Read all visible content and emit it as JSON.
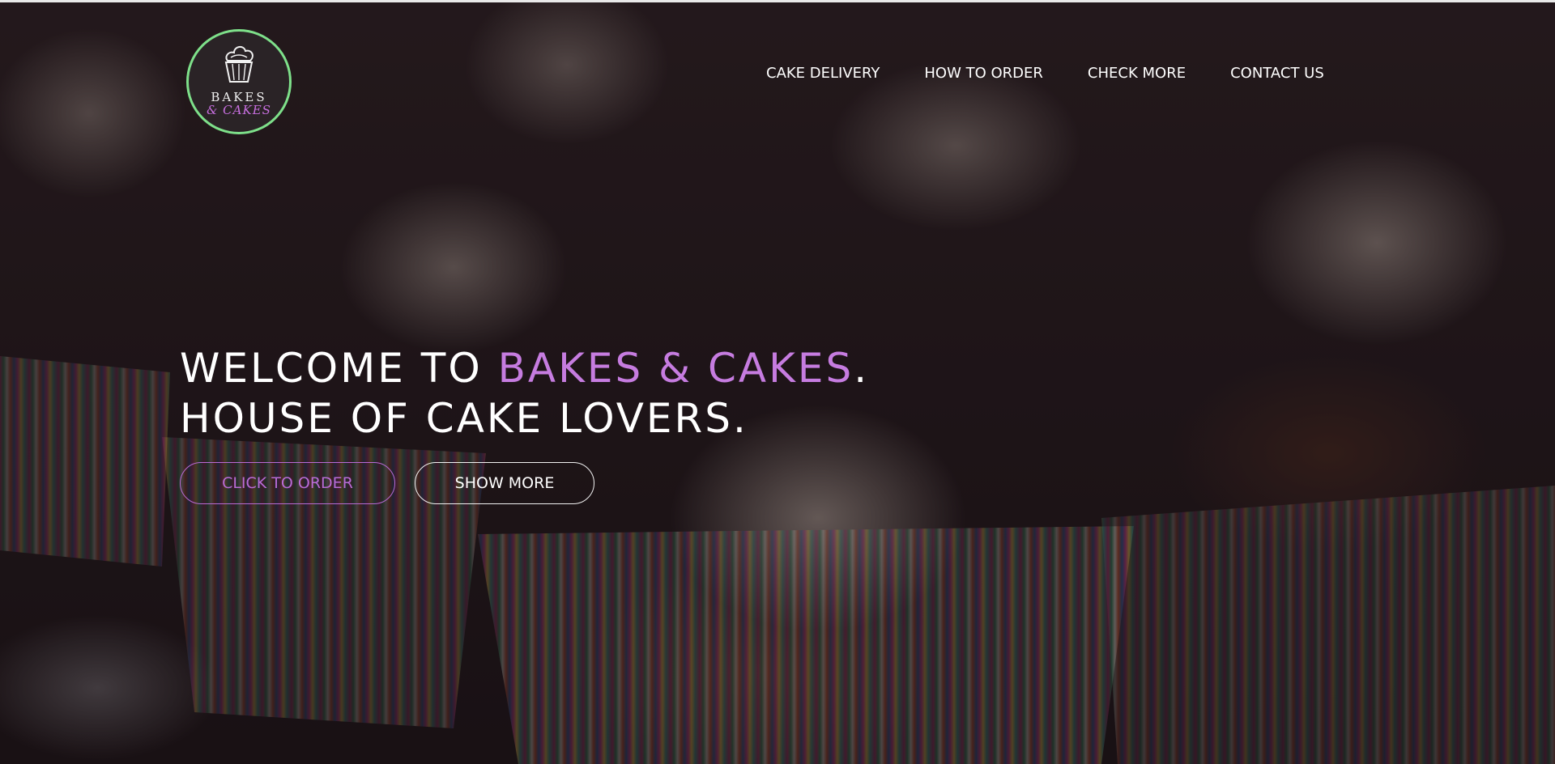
{
  "logo": {
    "line1": "BAKES",
    "line2": "& CAKES",
    "ring_color": "#7ee08a",
    "icon": "cupcake-icon"
  },
  "nav": {
    "items": [
      {
        "label": "CAKE DELIVERY"
      },
      {
        "label": "HOW TO ORDER"
      },
      {
        "label": "CHECK MORE"
      },
      {
        "label": "CONTACT US"
      }
    ]
  },
  "hero": {
    "line1_prefix": "WELCOME TO ",
    "line1_accent": "BAKES & CAKES",
    "line1_suffix": ".",
    "line2": "HOUSE OF CAKE LOVERS.",
    "accent_color": "#c67ce0"
  },
  "buttons": {
    "order_label": "CLICK TO ORDER",
    "more_label": "SHOW MORE"
  }
}
